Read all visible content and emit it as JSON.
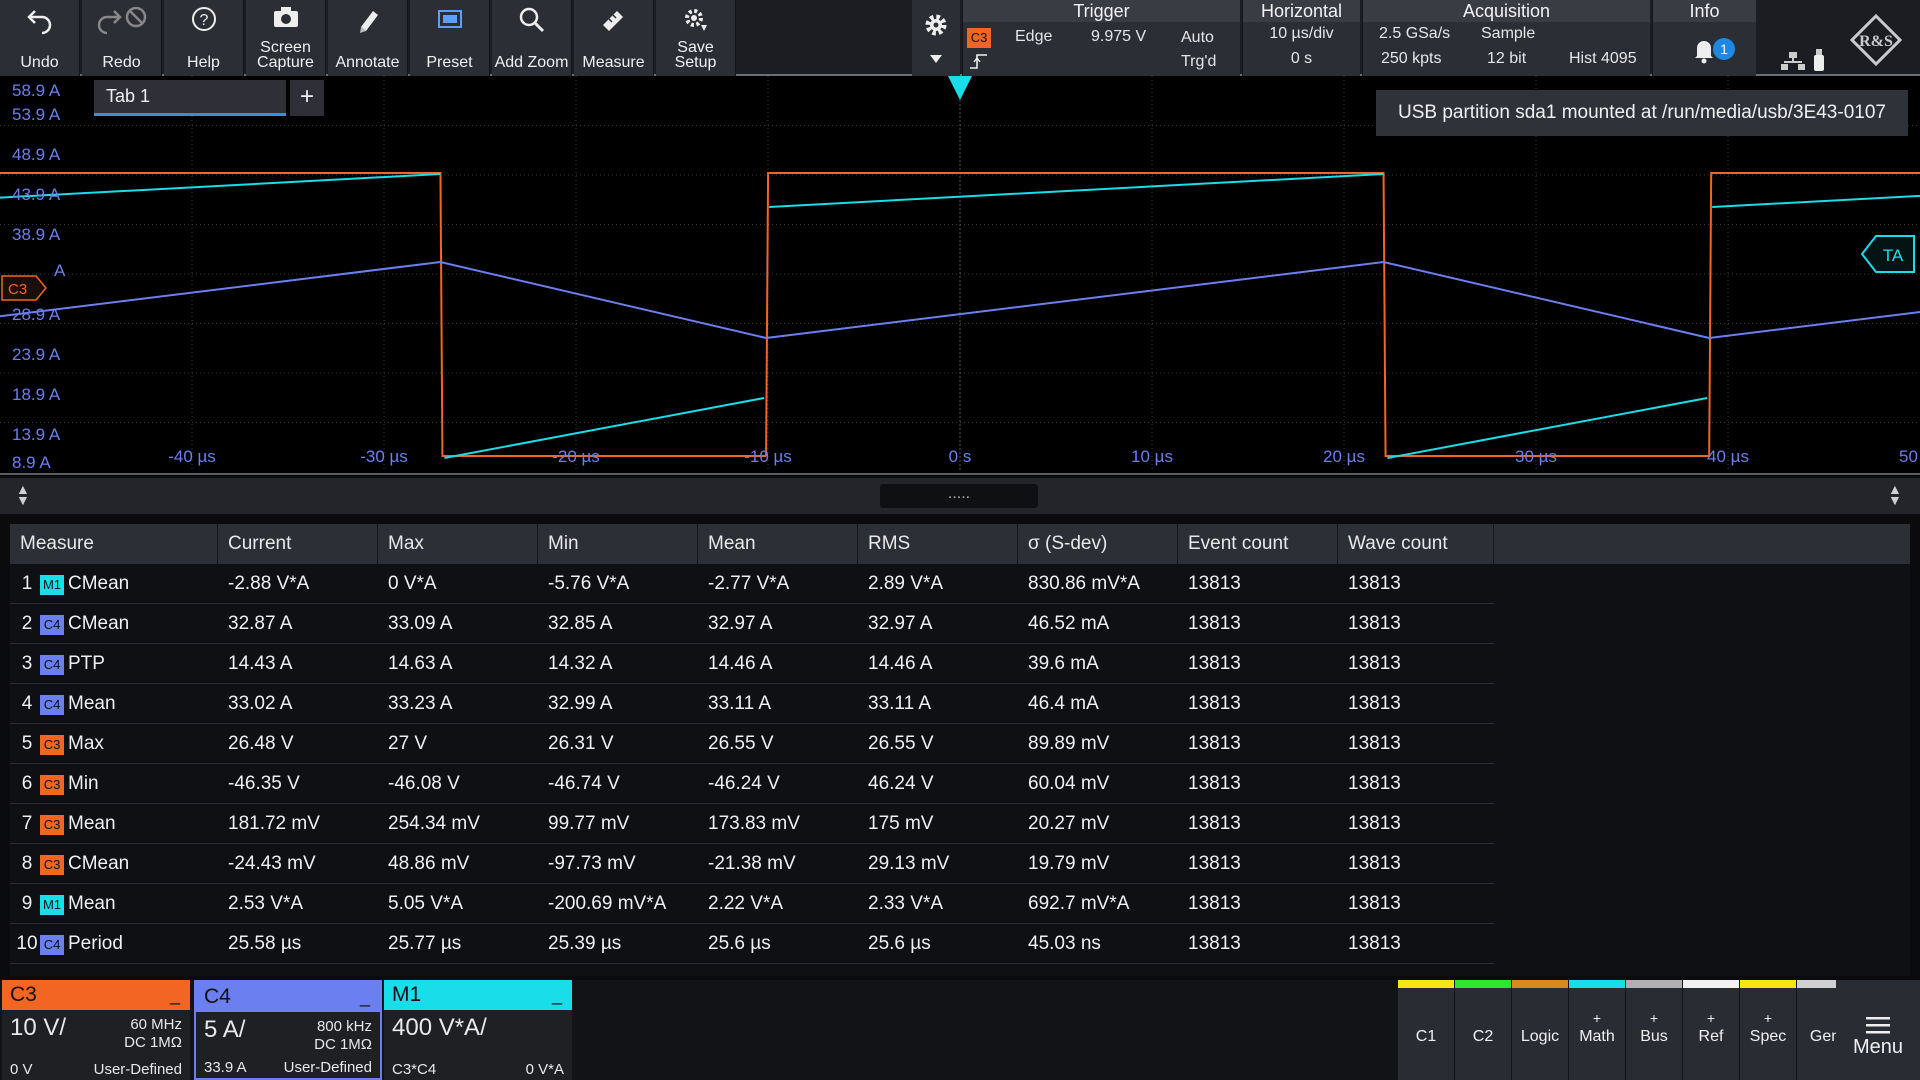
{
  "toolbar": {
    "undo": "Undo",
    "redo": "Redo",
    "help": "Help",
    "screen_capture": "Screen\nCapture",
    "annotate": "Annotate",
    "preset": "Preset",
    "add_zoom": "Add Zoom",
    "measure": "Measure",
    "save_setup": "Save\nSetup"
  },
  "trigger": {
    "title": "Trigger",
    "source": "C3",
    "type": "Edge",
    "level": "9.975 V",
    "mode": "Auto",
    "state": "Trg'd"
  },
  "horizontal": {
    "title": "Horizontal",
    "timebase": "10 µs/div",
    "position": "0 s"
  },
  "acquisition": {
    "title": "Acquisition",
    "sample_rate": "2.5 GSa/s",
    "mode": "Sample",
    "record_length": "250 kpts",
    "resolution": "12 bit",
    "hist": "Hist 4095"
  },
  "info": {
    "title": "Info",
    "notification_count": "1"
  },
  "waveform": {
    "tab_label": "Tab 1",
    "tab_add": "+",
    "usb_message": "USB partition sda1 mounted at /run/media/usb/3E43-0107",
    "y_labels": [
      "58.9 A",
      "53.9 A",
      "48.9 A",
      "43.9 A",
      "38.9 A",
      "A",
      "28.9 A",
      "23.9 A",
      "18.9 A",
      "13.9 A",
      "8.9 A"
    ],
    "c3_marker": "C3",
    "ta_marker": "TA",
    "x_labels": [
      "-40 µs",
      "-30 µs",
      "-20 µs",
      "-10 µs",
      "0 s",
      "10 µs",
      "20 µs",
      "30 µs",
      "40 µs",
      "50 µs"
    ]
  },
  "divider": {
    "grip": "....."
  },
  "measure_table": {
    "headers": [
      "Measure",
      "Current",
      "Max",
      "Min",
      "Mean",
      "RMS",
      "σ (S-dev)",
      "Event count",
      "Wave count"
    ],
    "rows": [
      {
        "num": "1",
        "src": "M1",
        "name": "CMean",
        "current": "-2.88 V*A",
        "max": "0 V*A",
        "min": "-5.76 V*A",
        "mean": "-2.77 V*A",
        "rms": "2.89 V*A",
        "sdev": "830.86 mV*A",
        "events": "13813",
        "waves": "13813"
      },
      {
        "num": "2",
        "src": "C4",
        "name": "CMean",
        "current": "32.87 A",
        "max": "33.09 A",
        "min": "32.85 A",
        "mean": "32.97 A",
        "rms": "32.97 A",
        "sdev": "46.52 mA",
        "events": "13813",
        "waves": "13813"
      },
      {
        "num": "3",
        "src": "C4",
        "name": "PTP",
        "current": "14.43 A",
        "max": "14.63 A",
        "min": "14.32 A",
        "mean": "14.46 A",
        "rms": "14.46 A",
        "sdev": "39.6 mA",
        "events": "13813",
        "waves": "13813"
      },
      {
        "num": "4",
        "src": "C4",
        "name": "Mean",
        "current": "33.02 A",
        "max": "33.23 A",
        "min": "32.99 A",
        "mean": "33.11 A",
        "rms": "33.11 A",
        "sdev": "46.4 mA",
        "events": "13813",
        "waves": "13813"
      },
      {
        "num": "5",
        "src": "C3",
        "name": "Max",
        "current": "26.48 V",
        "max": "27 V",
        "min": "26.31 V",
        "mean": "26.55 V",
        "rms": "26.55 V",
        "sdev": "89.89 mV",
        "events": "13813",
        "waves": "13813"
      },
      {
        "num": "6",
        "src": "C3",
        "name": "Min",
        "current": "-46.35 V",
        "max": "-46.08 V",
        "min": "-46.74 V",
        "mean": "-46.24 V",
        "rms": "46.24 V",
        "sdev": "60.04 mV",
        "events": "13813",
        "waves": "13813"
      },
      {
        "num": "7",
        "src": "C3",
        "name": "Mean",
        "current": "181.72 mV",
        "max": "254.34 mV",
        "min": "99.77 mV",
        "mean": "173.83 mV",
        "rms": "175 mV",
        "sdev": "20.27 mV",
        "events": "13813",
        "waves": "13813"
      },
      {
        "num": "8",
        "src": "C3",
        "name": "CMean",
        "current": "-24.43 mV",
        "max": "48.86 mV",
        "min": "-97.73 mV",
        "mean": "-21.38 mV",
        "rms": "29.13 mV",
        "sdev": "19.79 mV",
        "events": "13813",
        "waves": "13813"
      },
      {
        "num": "9",
        "src": "M1",
        "name": "Mean",
        "current": "2.53 V*A",
        "max": "5.05 V*A",
        "min": "-200.69 mV*A",
        "mean": "2.22 V*A",
        "rms": "2.33 V*A",
        "sdev": "692.7 mV*A",
        "events": "13813",
        "waves": "13813"
      },
      {
        "num": "10",
        "src": "C4",
        "name": "Period",
        "current": "25.58 µs",
        "max": "25.77 µs",
        "min": "25.39 µs",
        "mean": "25.6 µs",
        "rms": "25.6 µs",
        "sdev": "45.03 ns",
        "events": "13813",
        "waves": "13813"
      }
    ]
  },
  "channels": [
    {
      "id": "C3",
      "scale": "10 V/",
      "bandwidth": "60 MHz",
      "coupling": "DC 1MΩ",
      "offset": "0 V",
      "mode": "User-Defined",
      "color": "#f26522"
    },
    {
      "id": "C4",
      "scale": "5 A/",
      "bandwidth": "800 kHz",
      "coupling": "DC 1MΩ",
      "offset": "33.9 A",
      "mode": "User-Defined",
      "color": "#6b7ff0"
    },
    {
      "id": "M1",
      "scale": "400 V*A/",
      "expr": "C3*C4",
      "offset": "0 V*A",
      "color": "#19dde8"
    }
  ],
  "right_buttons": [
    {
      "label": "C1",
      "color": "#f5e614",
      "plus": ""
    },
    {
      "label": "C2",
      "color": "#2ee62e",
      "plus": ""
    },
    {
      "label": "Logic",
      "color": "#d98a1e",
      "plus": ""
    },
    {
      "label": "Math",
      "color": "#19dde8",
      "plus": "+"
    },
    {
      "label": "Bus",
      "color": "#b0b0b4",
      "plus": "+"
    },
    {
      "label": "Ref",
      "color": "#f2f2f2",
      "plus": "+"
    },
    {
      "label": "Spec",
      "color": "#f5e614",
      "plus": "+"
    },
    {
      "label": "Gen",
      "color": "#d0d0d4",
      "plus": ""
    }
  ],
  "menu": {
    "label": "Menu"
  },
  "colors": {
    "c3": "#f26522",
    "c4": "#6b7ff0",
    "m1": "#19dde8",
    "grid": "#3a3a3e"
  }
}
